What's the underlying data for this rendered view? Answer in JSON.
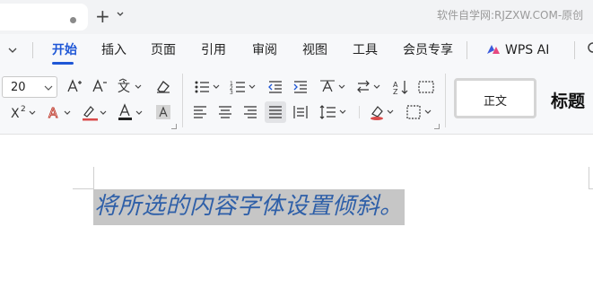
{
  "tabstrip": {
    "new_tab_symbol": "+",
    "watermark": "软件自学网:RJZXW.COM-原创"
  },
  "ribbon": {
    "tabs": [
      {
        "label": "开始",
        "active": true
      },
      {
        "label": "插入"
      },
      {
        "label": "页面"
      },
      {
        "label": "引用"
      },
      {
        "label": "审阅"
      },
      {
        "label": "视图"
      },
      {
        "label": "工具"
      },
      {
        "label": "会员专享"
      }
    ],
    "wps_ai_label": "WPS AI"
  },
  "toolbar": {
    "font_size": "20",
    "style_normal": "正文",
    "style_heading": "标题"
  },
  "document": {
    "text": "将所选的内容字体设置倾斜。"
  },
  "colors": {
    "accent": "#1f57d6",
    "text_color": "#2e5fa8",
    "selection": "#c6c6c6",
    "font_color_bar": "#222222",
    "highlight_bar": "#d94a4a"
  }
}
